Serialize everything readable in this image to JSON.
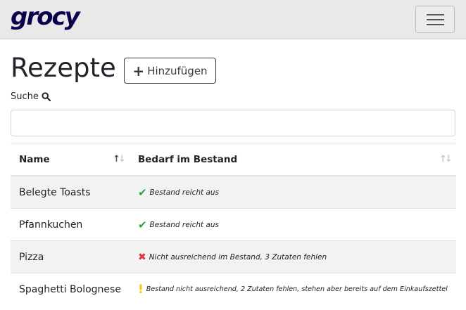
{
  "app": {
    "logo": "grocy"
  },
  "page": {
    "title": "Rezepte",
    "add_label": "Hinzufügen",
    "add_icon": "plus-icon"
  },
  "search": {
    "label": "Suche",
    "value": "",
    "placeholder": ""
  },
  "table": {
    "columns": [
      "Name",
      "Bedarf im Bestand"
    ],
    "rows": [
      {
        "name": "Belegte Toasts",
        "status": "Bestand reicht aus",
        "status_icon": "check-icon",
        "status_color": "#28a745"
      },
      {
        "name": "Pfannkuchen",
        "status": "Bestand reicht aus",
        "status_icon": "check-icon",
        "status_color": "#28a745"
      },
      {
        "name": "Pizza",
        "status": "Nicht ausreichend im Bestand, 3 Zutaten fehlen",
        "status_icon": "times-icon",
        "status_color": "#dc3545"
      },
      {
        "name": "Spaghetti Bolognese",
        "status": "Bestand nicht ausreichend, 2 Zutaten fehlen, stehen aber bereits auf dem Einkaufszettel",
        "status_icon": "exclamation-icon",
        "status_color": "#ffc107"
      }
    ]
  },
  "colors": {
    "brand": "#0b024c",
    "navbar_bg": "#e9e9e9"
  }
}
